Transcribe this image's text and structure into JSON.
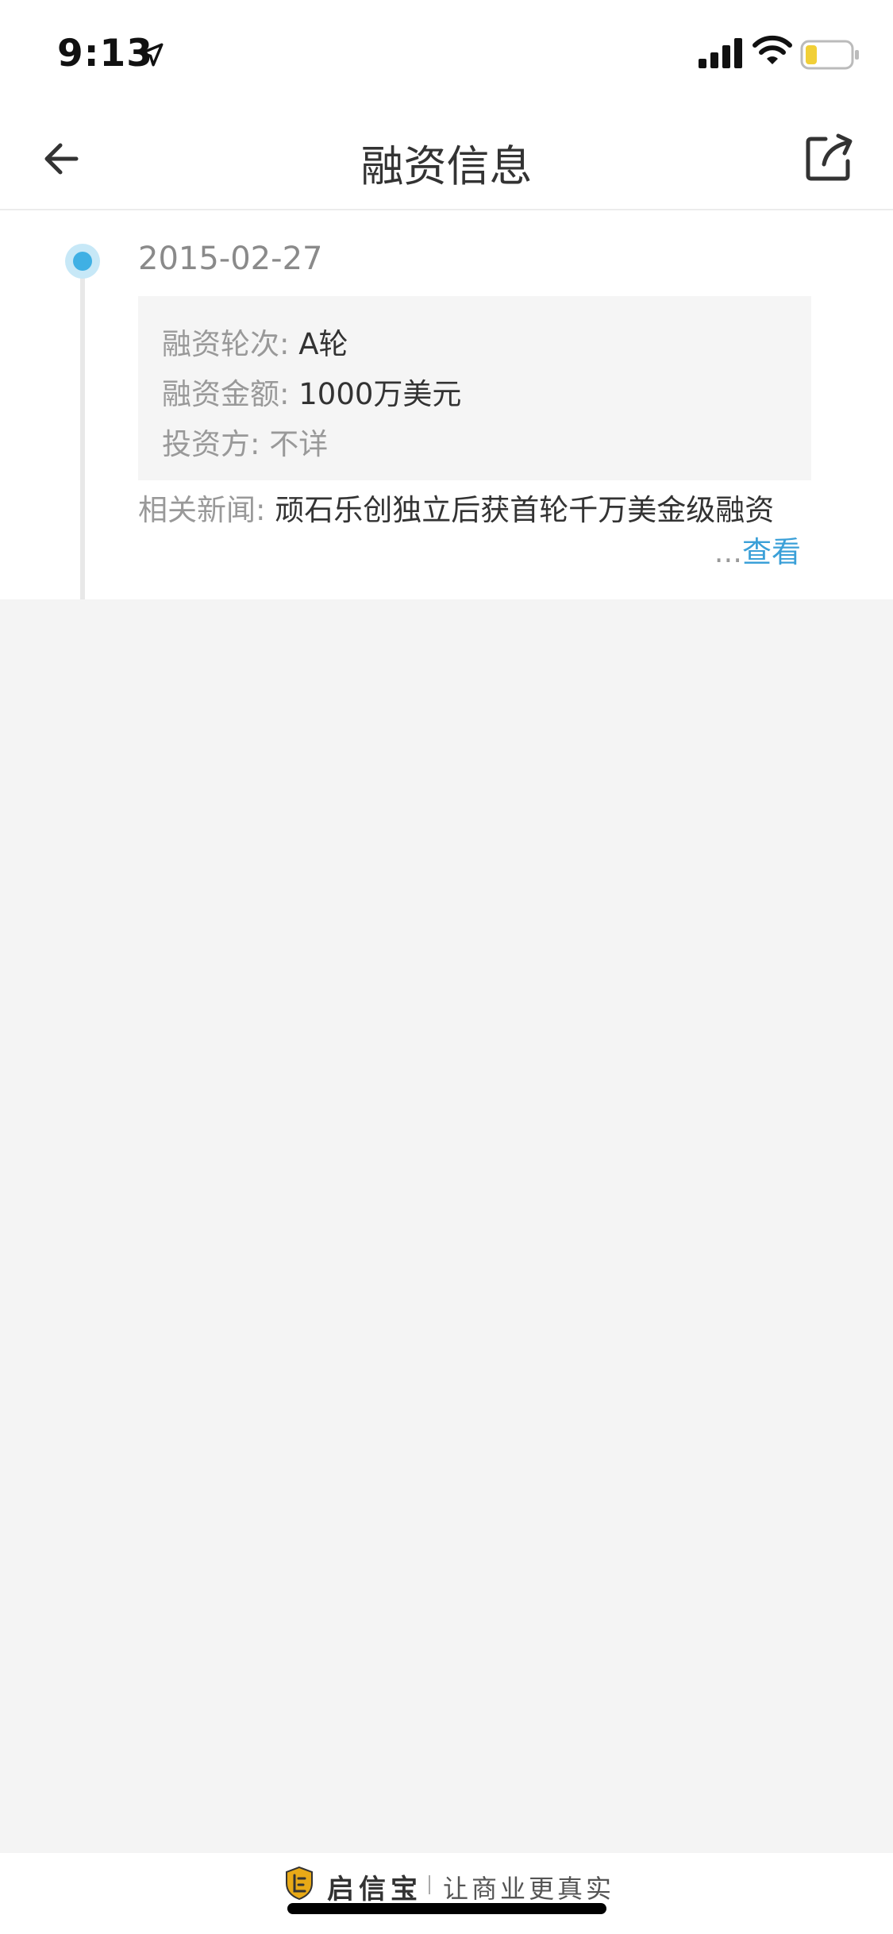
{
  "status_bar": {
    "time": "9:13",
    "icons": [
      "location-arrow-icon",
      "signal-icon",
      "wifi-icon",
      "battery-icon"
    ]
  },
  "nav": {
    "title": "融资信息",
    "back_icon": "arrow-left-icon",
    "share_icon": "share-icon"
  },
  "financing": {
    "date": "2015-02-27",
    "round_label": "融资轮次:",
    "round_value": "A轮",
    "amount_label": "融资金额:",
    "amount_value": "1000万美元",
    "investor_label": "投资方:",
    "investor_value": "不详",
    "news_label": "相关新闻:",
    "news_text": "顽石乐创独立后获首轮千万美金级融资",
    "ellipsis": "...",
    "view_label": "查看"
  },
  "footer": {
    "brand": "启信宝",
    "slogan": "让商业更真实"
  },
  "colors": {
    "accent": "#3ba0d8",
    "timeline_dot": "#3fb0e4",
    "background": "#f4f4f4",
    "brand_gold": "#e8a917"
  }
}
